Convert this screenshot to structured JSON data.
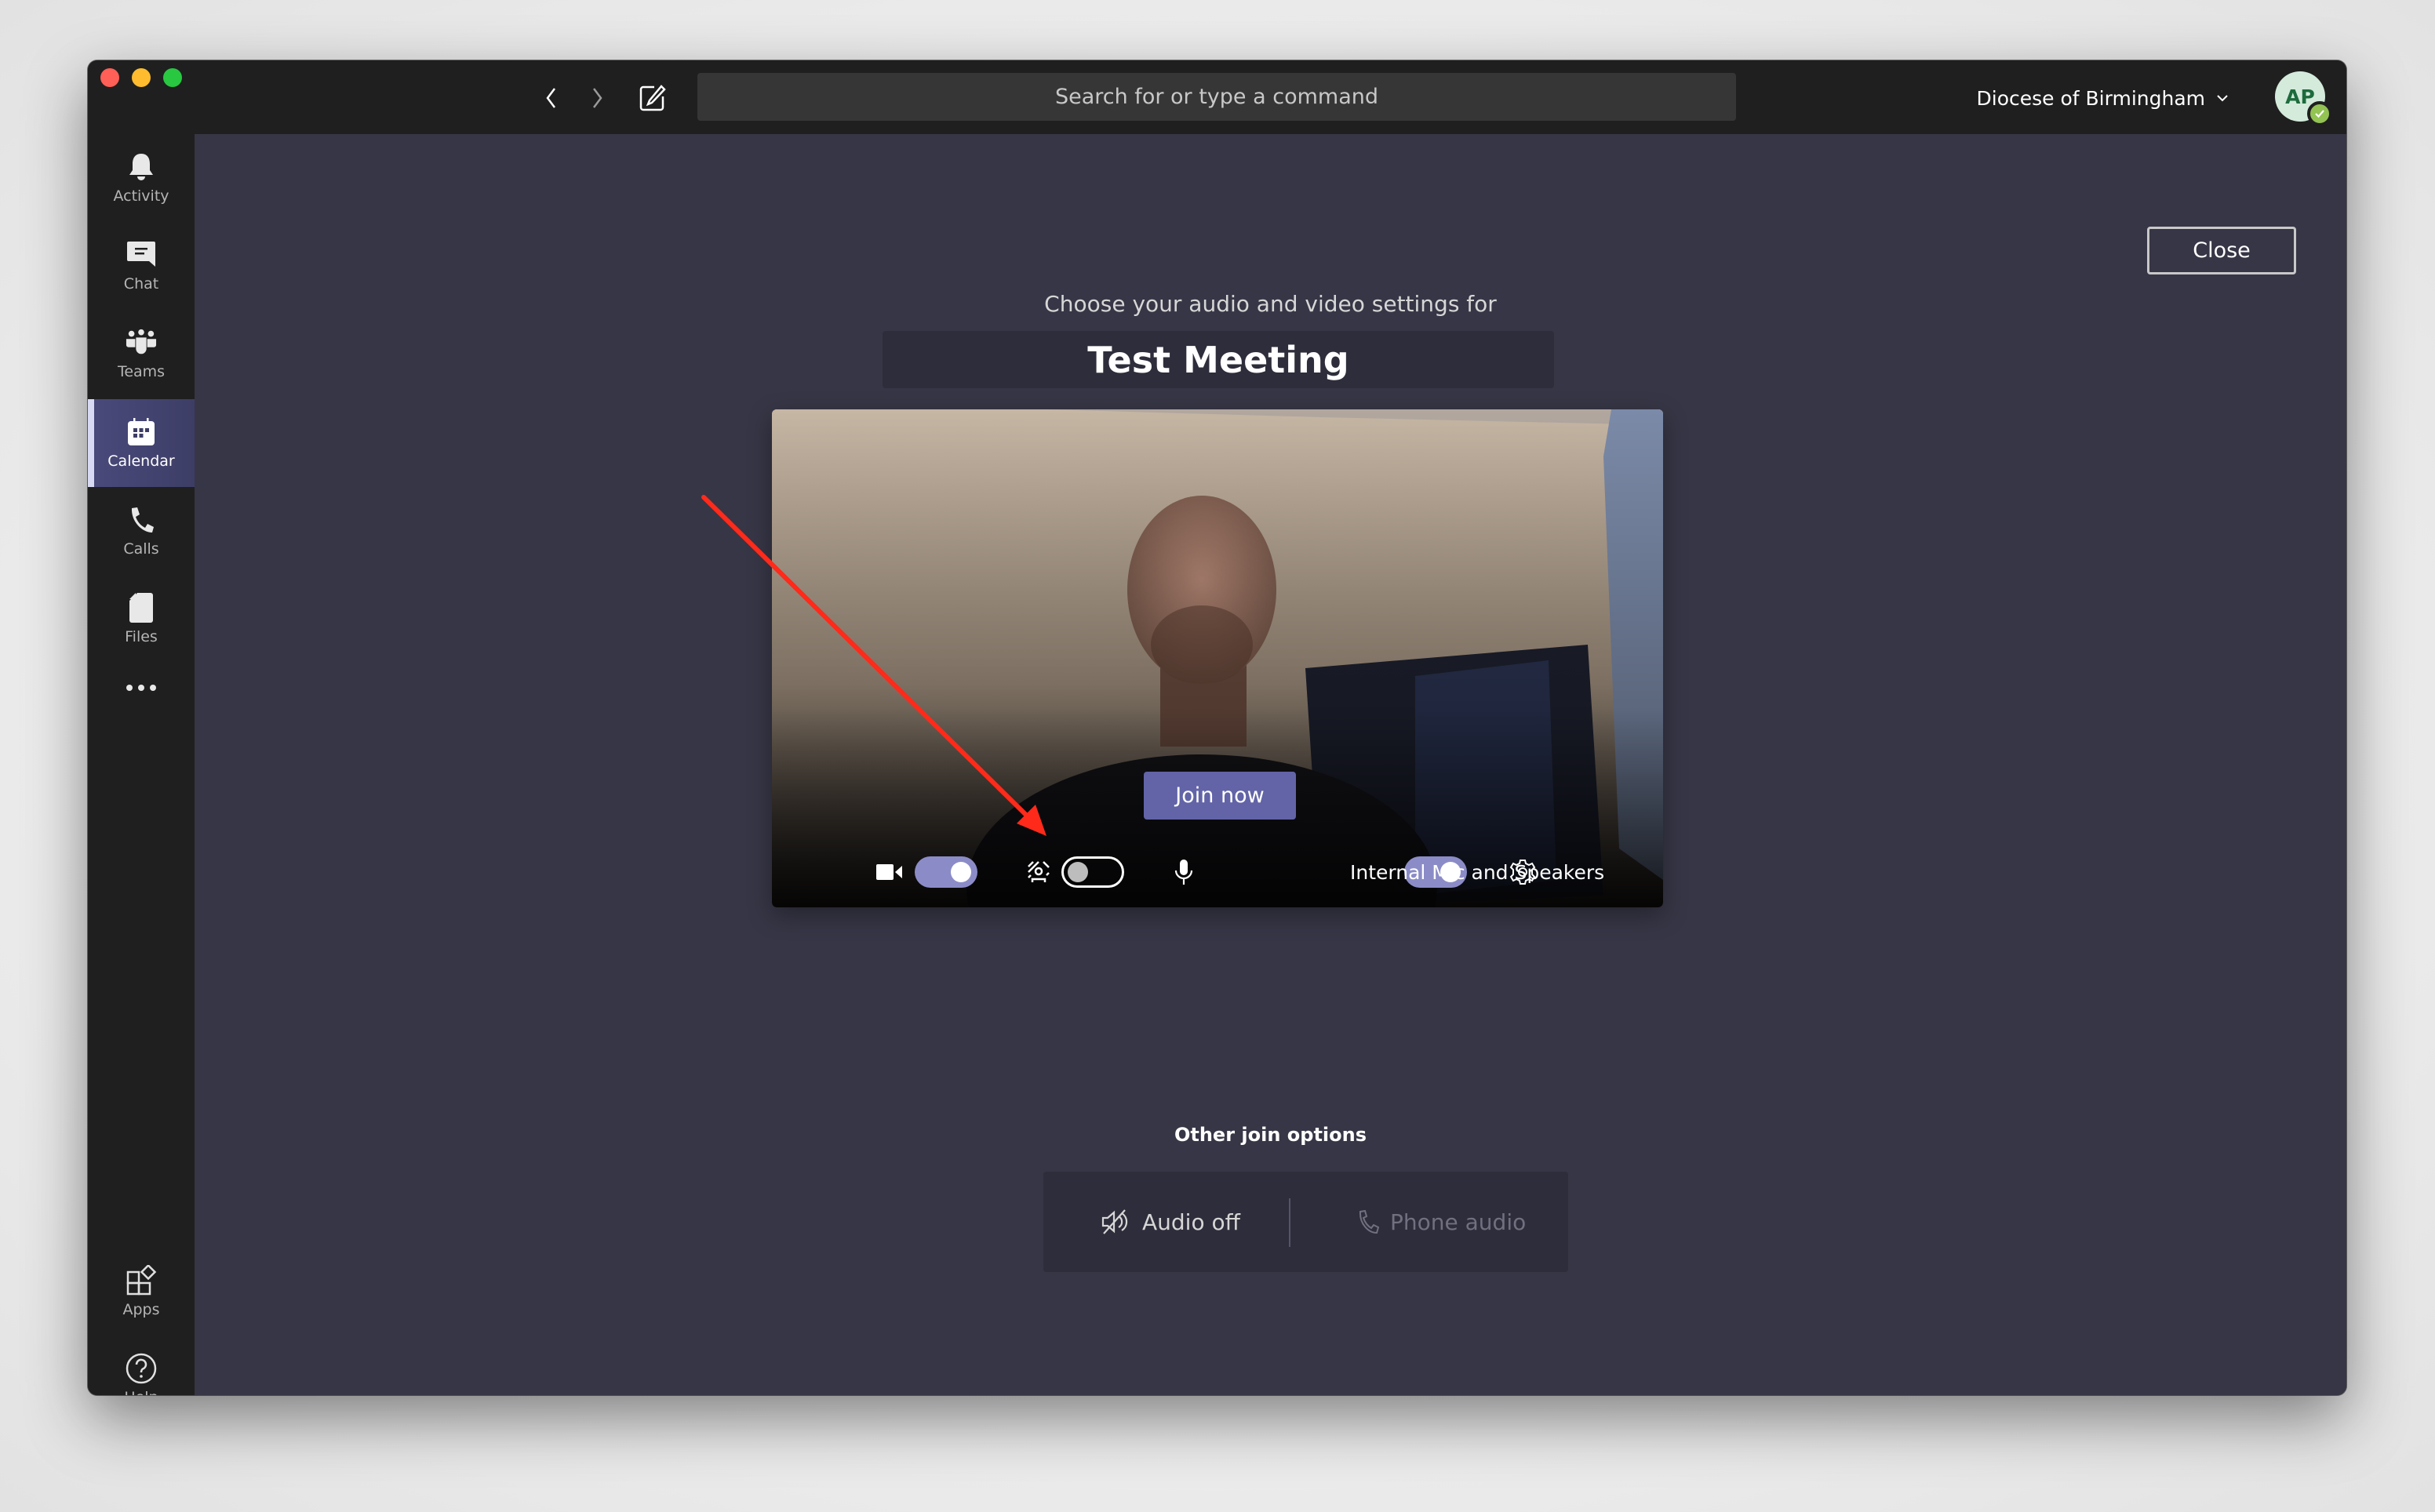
{
  "titlebar": {
    "back_icon": "chevron-left-icon",
    "forward_icon": "chevron-right-icon",
    "compose_icon": "compose-icon",
    "search_placeholder": "Search for or type a command",
    "org_name": "Diocese of Birmingham",
    "org_dropdown_icon": "chevron-down-icon",
    "avatar_initials": "AP",
    "presence": "available"
  },
  "sidebar": {
    "items": [
      {
        "label": "Activity",
        "icon": "bell-icon"
      },
      {
        "label": "Chat",
        "icon": "chat-icon"
      },
      {
        "label": "Teams",
        "icon": "teams-icon"
      },
      {
        "label": "Calendar",
        "icon": "calendar-icon",
        "active": true
      },
      {
        "label": "Calls",
        "icon": "phone-icon"
      },
      {
        "label": "Files",
        "icon": "file-icon"
      },
      {
        "label": "",
        "icon": "more-icon"
      }
    ],
    "bottom_items": [
      {
        "label": "Apps",
        "icon": "apps-icon"
      },
      {
        "label": "Help",
        "icon": "help-icon"
      }
    ]
  },
  "main": {
    "close_label": "Close",
    "subtitle": "Choose your audio and video settings for",
    "meeting_title": "Test Meeting",
    "join_label": "Join now",
    "controls": {
      "camera_on": true,
      "background_blur_on": false,
      "mic_on": true,
      "device_label": "Internal Mic and Speakers"
    },
    "other_options_title": "Other join options",
    "options": [
      {
        "label": "Audio off",
        "icon": "speaker-off-icon",
        "enabled": true
      },
      {
        "label": "Phone audio",
        "icon": "phone-icon",
        "enabled": false
      }
    ]
  },
  "colors": {
    "accent": "#6264a7",
    "toggle_on": "#8b8cc7",
    "main_bg": "#373646",
    "chrome_bg": "#1f1f1f",
    "annotation_arrow": "#ff2a1a"
  }
}
